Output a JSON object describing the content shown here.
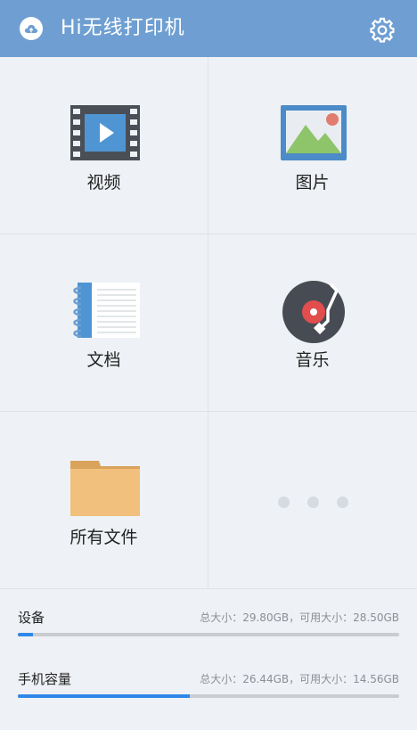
{
  "header": {
    "title": "Hi无线打印机",
    "app_icon": "cloud-icon",
    "settings_icon": "gear-icon",
    "colors": {
      "bar": "#6f9fd2"
    }
  },
  "tiles": [
    {
      "label": "视频",
      "icon": "video-film-icon"
    },
    {
      "label": "图片",
      "icon": "picture-icon"
    },
    {
      "label": "文档",
      "icon": "notebook-icon"
    },
    {
      "label": "音乐",
      "icon": "record-player-icon"
    },
    {
      "label": "所有文件",
      "icon": "folder-icon"
    },
    {
      "label": "",
      "icon": "more-dots-icon"
    }
  ],
  "storage": [
    {
      "name": "设备",
      "info": "总大小：29.80GB，可用大小：28.50GB",
      "used_fraction": 0.04
    },
    {
      "name": "手机容量",
      "info": "总大小：26.44GB，可用大小：14.56GB",
      "used_fraction": 0.45
    }
  ],
  "colors": {
    "accent": "#2f87e8",
    "background": "#eef1f5"
  }
}
